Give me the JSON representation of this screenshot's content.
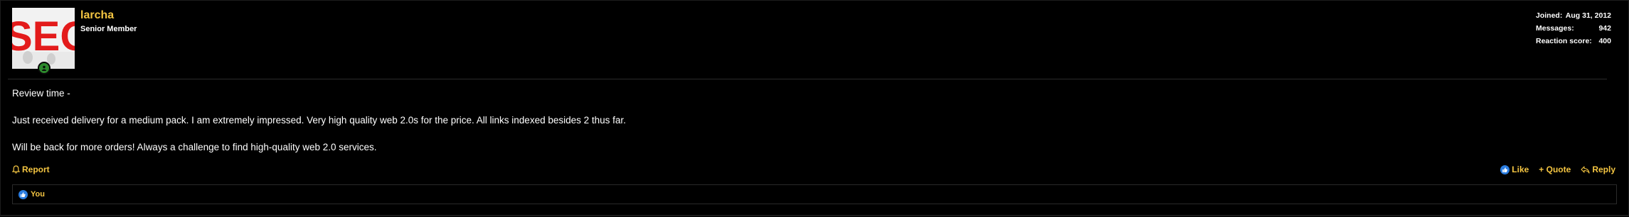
{
  "user": {
    "name": "larcha",
    "title": "Senior Member",
    "avatar_text": "SEO",
    "status_icon": "online-status-icon"
  },
  "stats": [
    {
      "label": "Joined:",
      "value": "Aug 31, 2012"
    },
    {
      "label": "Messages:",
      "value": "942"
    },
    {
      "label": "Reaction score:",
      "value": "400"
    }
  ],
  "message": {
    "paragraphs": [
      "Review time -",
      "Just received delivery for a medium pack. I am extremely impressed. Very high quality web 2.0s for the price. All links indexed besides 2 thus far.",
      "Will be back for more orders! Always a challenge to find high-quality web 2.0 services."
    ]
  },
  "actions": {
    "report": "Report",
    "like": "Like",
    "quote": "+ Quote",
    "reply": "Reply"
  },
  "reactions": {
    "icon": "like-icon",
    "users": "You"
  },
  "colors": {
    "accent": "#f4c542",
    "background": "#000000",
    "border": "#2a2a2a",
    "like_blue": "#2b7de0",
    "online_green": "#2d8a2d"
  }
}
